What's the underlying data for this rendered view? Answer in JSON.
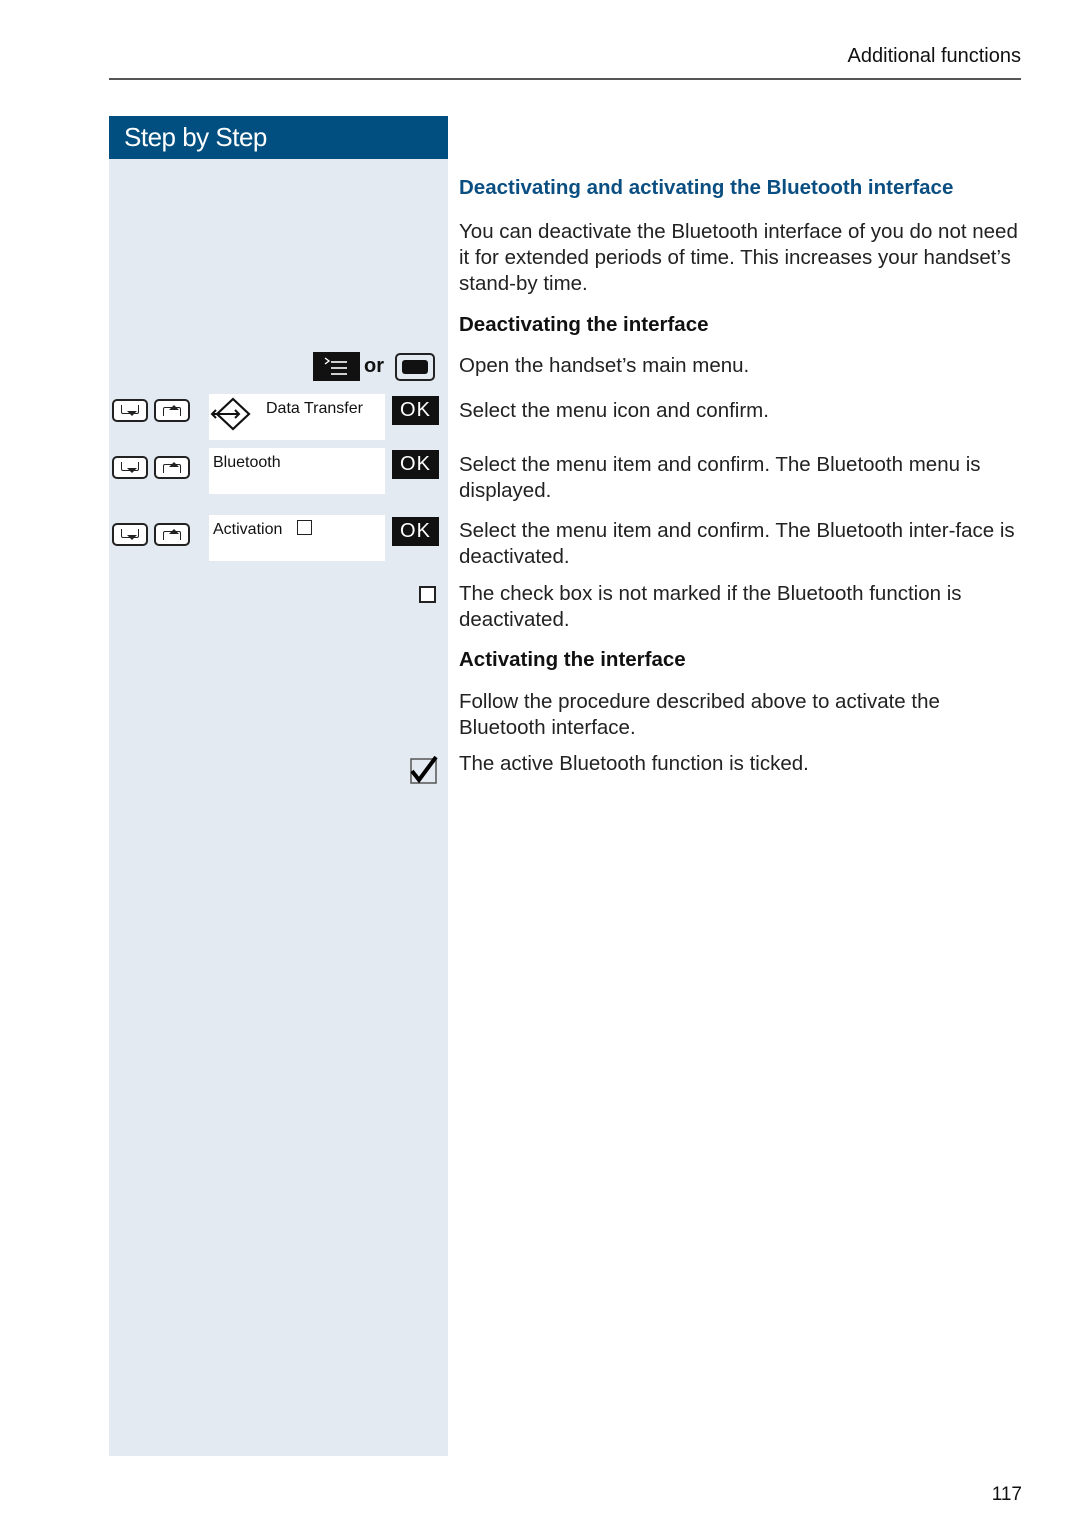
{
  "header": {
    "section_title": "Additional functions"
  },
  "sidebar": {
    "title": "Step by Step"
  },
  "main": {
    "title": "Deactivating and activating the Bluetooth interface",
    "intro": "You can deactivate the Bluetooth interface of you do not need it for extended periods of time. This increases your handset’s stand-by time.",
    "deactivate_heading": "Deactivating the interface",
    "steps": [
      {
        "text": "Open the handset’s main menu."
      },
      {
        "text": "Select the menu icon and confirm."
      },
      {
        "text": "Select the menu item and confirm. The Bluetooth menu is displayed."
      },
      {
        "text": "Select the menu item and confirm. The Bluetooth inter-face is deactivated."
      }
    ],
    "unchecked_note": "The check box is not marked if the Bluetooth function is deactivated.",
    "activate_heading": "Activating the interface",
    "activate_text": "Follow the procedure described above to activate the Bluetooth interface.",
    "checked_note": "The active Bluetooth function is ticked."
  },
  "keys": {
    "or_label": "or",
    "ok_label": "OK"
  },
  "screens": [
    {
      "label": "Data Transfer",
      "icon": "data-transfer-icon"
    },
    {
      "label": "Bluetooth"
    },
    {
      "label": "Activation",
      "checkbox": "unchecked"
    }
  ],
  "footer": {
    "page_number": "117"
  }
}
